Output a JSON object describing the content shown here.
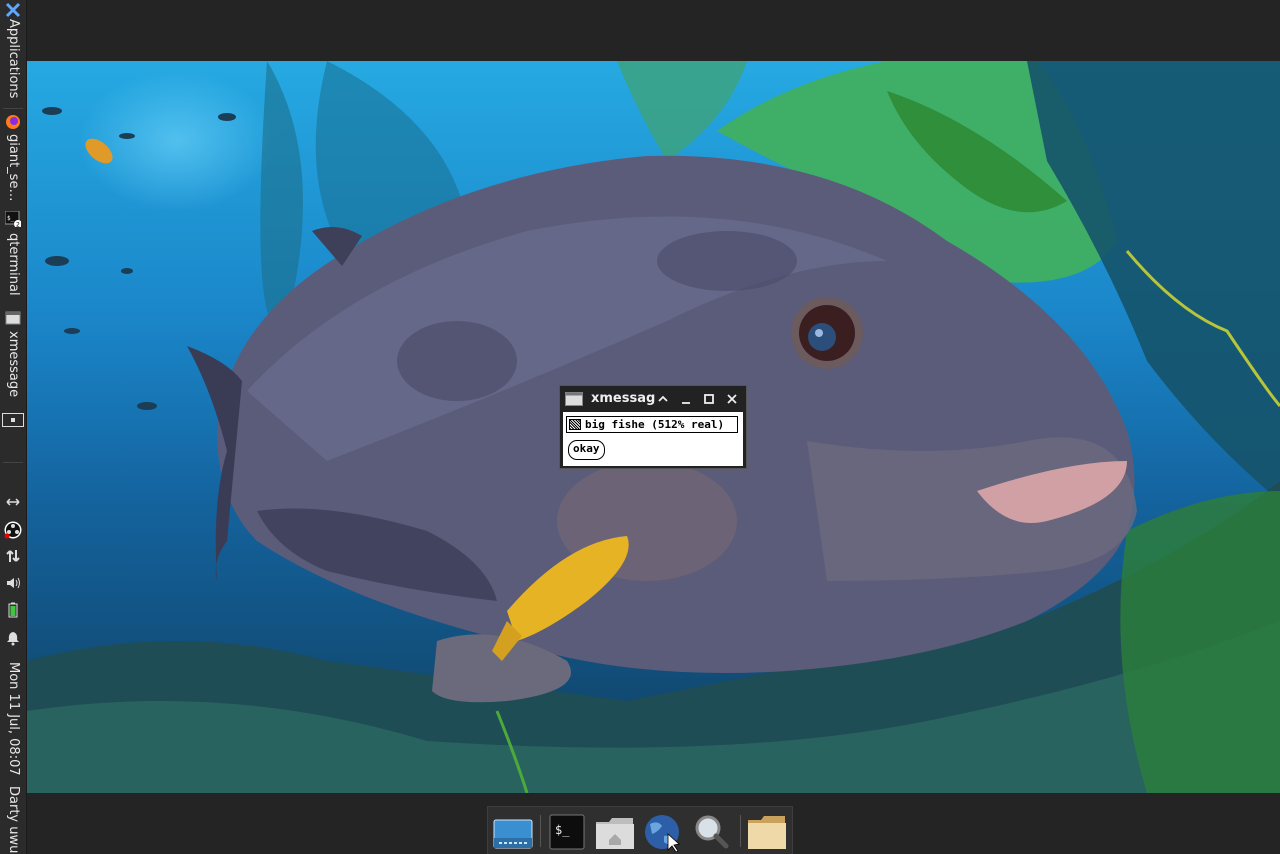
{
  "left_panel": {
    "applications_label": "Applications",
    "tasks": [
      {
        "label": "giant_se…",
        "icon": "firefox-icon"
      },
      {
        "label": "qterminal",
        "icon": "terminal-icon",
        "badge": "2"
      },
      {
        "label": "xmessage",
        "icon": "window-icon"
      }
    ],
    "tray_icons": [
      "resize-arrows-icon",
      "obs-record-icon",
      "network-arrows-icon",
      "volume-icon",
      "battery-icon",
      "bell-icon"
    ],
    "clock": "Mon 11 Jul, 08:07",
    "user": "Darty uwu"
  },
  "xmessage": {
    "title": "xmessag",
    "message": "big fishe (512% real)",
    "button_label": "okay"
  },
  "dock": {
    "items": [
      "show-desktop-icon",
      "terminal-icon",
      "home-folder-icon",
      "web-browser-icon",
      "search-icon",
      "folder-icon"
    ]
  },
  "colors": {
    "panel_bg": "#2b2b2b",
    "water_top": "#26a9e2",
    "water_deep": "#0f3e5e",
    "kelp": "#3fae4b",
    "fish": "#5a5a78"
  }
}
